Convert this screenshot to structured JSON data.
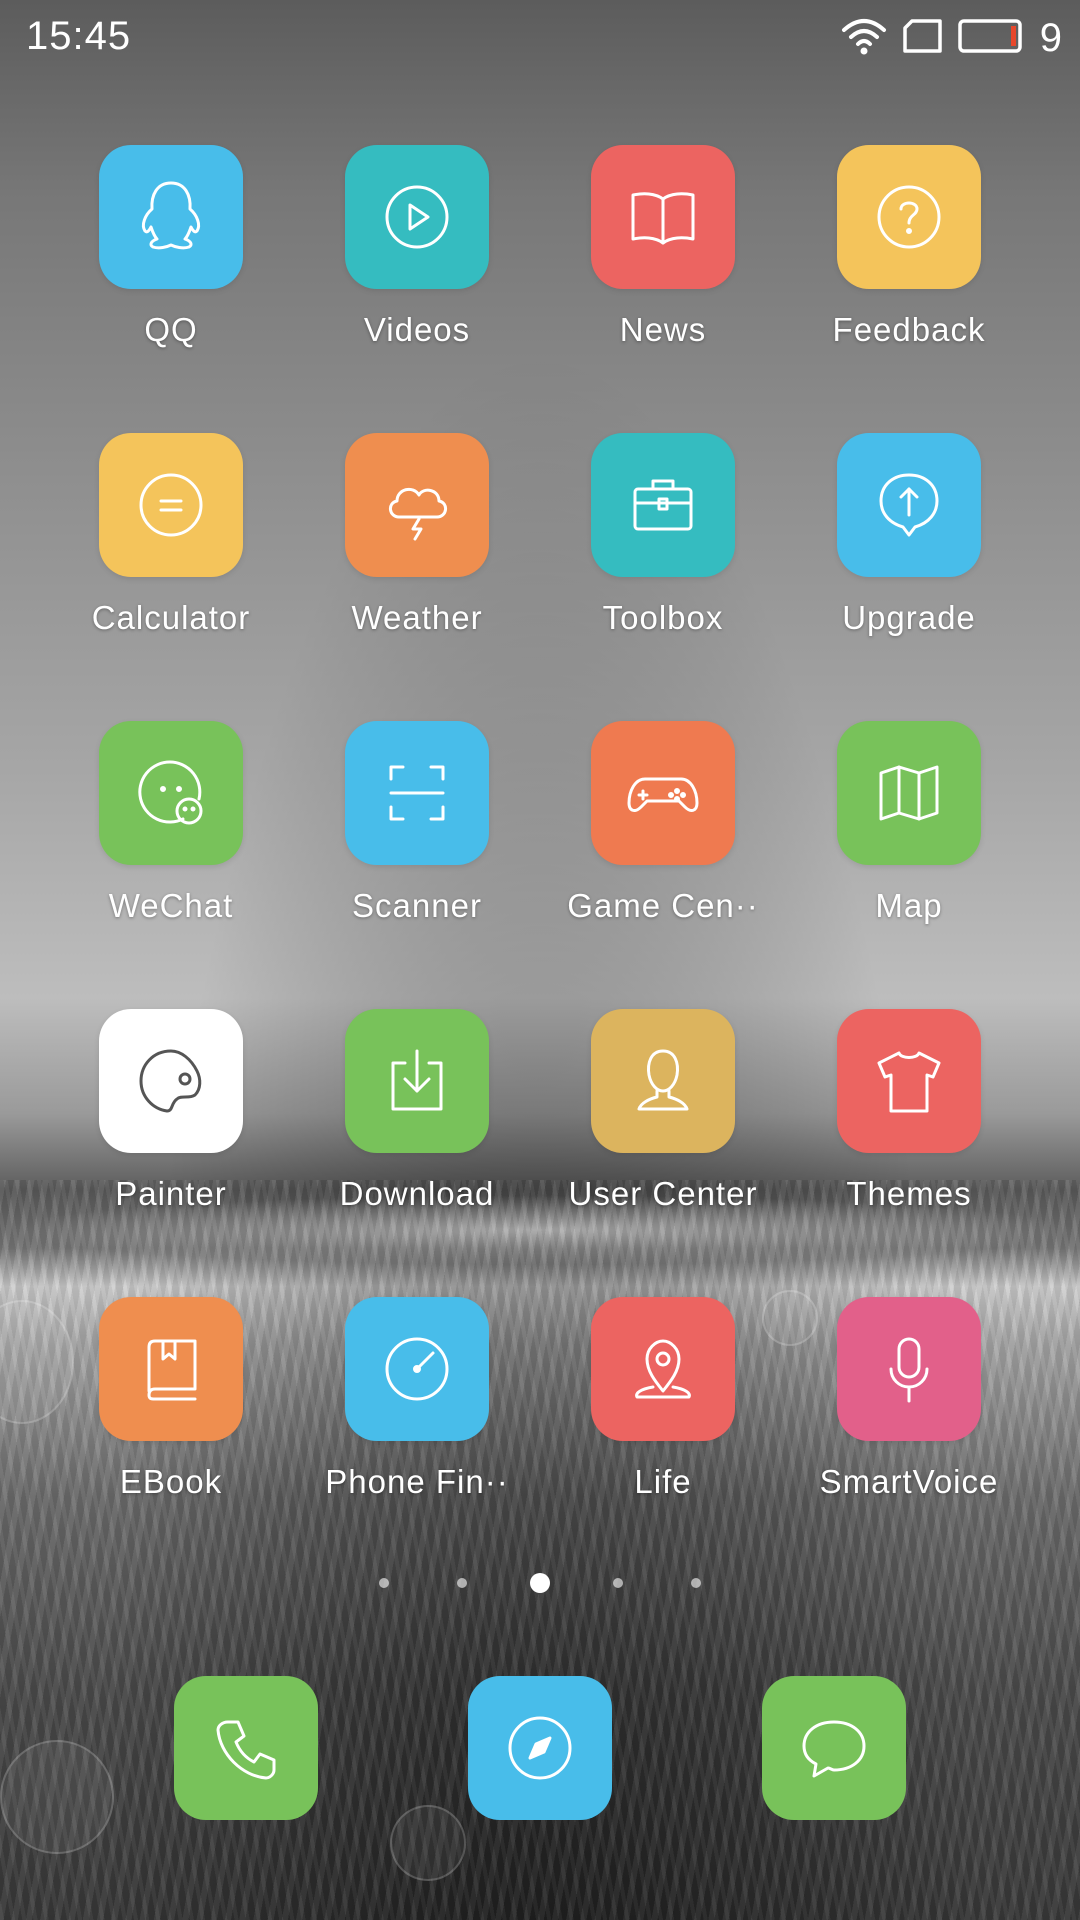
{
  "status_bar": {
    "time": "15:45",
    "battery_level": "9",
    "icons": [
      "wifi-icon",
      "sim-icon",
      "battery-icon"
    ]
  },
  "apps": [
    {
      "label": "QQ",
      "icon": "penguin-icon",
      "color": "#48BDEA"
    },
    {
      "label": "Videos",
      "icon": "play-icon",
      "color": "#35BCC0"
    },
    {
      "label": "News",
      "icon": "open-book-icon",
      "color": "#EC6461"
    },
    {
      "label": "Feedback",
      "icon": "question-icon",
      "color": "#F4C45B"
    },
    {
      "label": "Calculator",
      "icon": "equals-icon",
      "color": "#F4C45B"
    },
    {
      "label": "Weather",
      "icon": "storm-cloud-icon",
      "color": "#EF8E4F"
    },
    {
      "label": "Toolbox",
      "icon": "briefcase-icon",
      "color": "#35BCC0"
    },
    {
      "label": "Upgrade",
      "icon": "upload-arrow-icon",
      "color": "#48BDEA"
    },
    {
      "label": "WeChat",
      "icon": "chat-faces-icon",
      "color": "#78C25A"
    },
    {
      "label": "Scanner",
      "icon": "scan-frame-icon",
      "color": "#48BDEA"
    },
    {
      "label": "Game Cen··",
      "icon": "gamepad-icon",
      "color": "#EF7A50"
    },
    {
      "label": "Map",
      "icon": "map-icon",
      "color": "#78C25A"
    },
    {
      "label": "Painter",
      "icon": "palette-icon",
      "color": "#FFFFFF"
    },
    {
      "label": "Download",
      "icon": "download-icon",
      "color": "#78C25A"
    },
    {
      "label": "User Center",
      "icon": "user-icon",
      "color": "#DCB45E"
    },
    {
      "label": "Themes",
      "icon": "tshirt-icon",
      "color": "#EC6461"
    },
    {
      "label": "EBook",
      "icon": "book-icon",
      "color": "#EF8E4F"
    },
    {
      "label": "Phone Fin··",
      "icon": "gauge-icon",
      "color": "#48BDEA"
    },
    {
      "label": "Life",
      "icon": "location-pin-icon",
      "color": "#EC6461"
    },
    {
      "label": "SmartVoice",
      "icon": "microphone-icon",
      "color": "#E2608A"
    }
  ],
  "page_indicator": {
    "pages": 5,
    "current": 3
  },
  "dock": [
    {
      "name": "Phone",
      "icon": "phone-icon",
      "color": "#78C25A"
    },
    {
      "name": "Browser",
      "icon": "compass-icon",
      "color": "#48BDEA"
    },
    {
      "name": "Messages",
      "icon": "message-bubble-icon",
      "color": "#78C25A"
    }
  ]
}
